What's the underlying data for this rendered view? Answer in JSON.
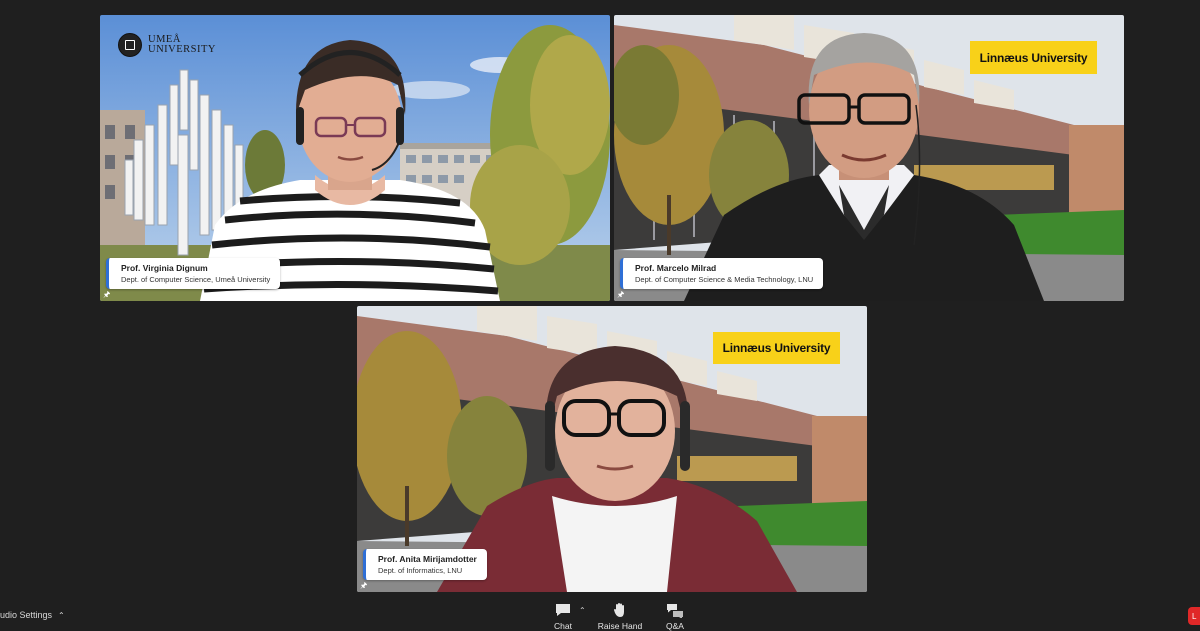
{
  "participants": [
    {
      "name": "Prof. Virginia Dignum",
      "department": "Dept. of Computer Science, Umeå University",
      "background_brand": "UMEÅ UNIVERSITY",
      "background_brand_line1": "UMEÅ",
      "background_brand_line2": "UNIVERSITY"
    },
    {
      "name": "Prof. Marcelo Milrad",
      "department": "Dept. of Computer Science & Media Technology, LNU",
      "background_brand": "Linnæus University"
    },
    {
      "name": "Prof. Anita Mirijamdotter",
      "department": "Dept. of Informatics, LNU",
      "background_brand": "Linnæus University"
    }
  ],
  "toolbar": {
    "audio_settings_label": "udio Settings",
    "chat_label": "Chat",
    "raise_hand_label": "Raise Hand",
    "qa_label": "Q&A",
    "leave_label": "L"
  },
  "colors": {
    "background": "#1f1f1f",
    "brand_yellow": "#f8d119",
    "nametag_accent": "#2f6fd6",
    "leave_red": "#e02828"
  },
  "icons": [
    "pin-icon",
    "chat-icon",
    "raise-hand-icon",
    "qa-icon",
    "caret-up-icon"
  ]
}
